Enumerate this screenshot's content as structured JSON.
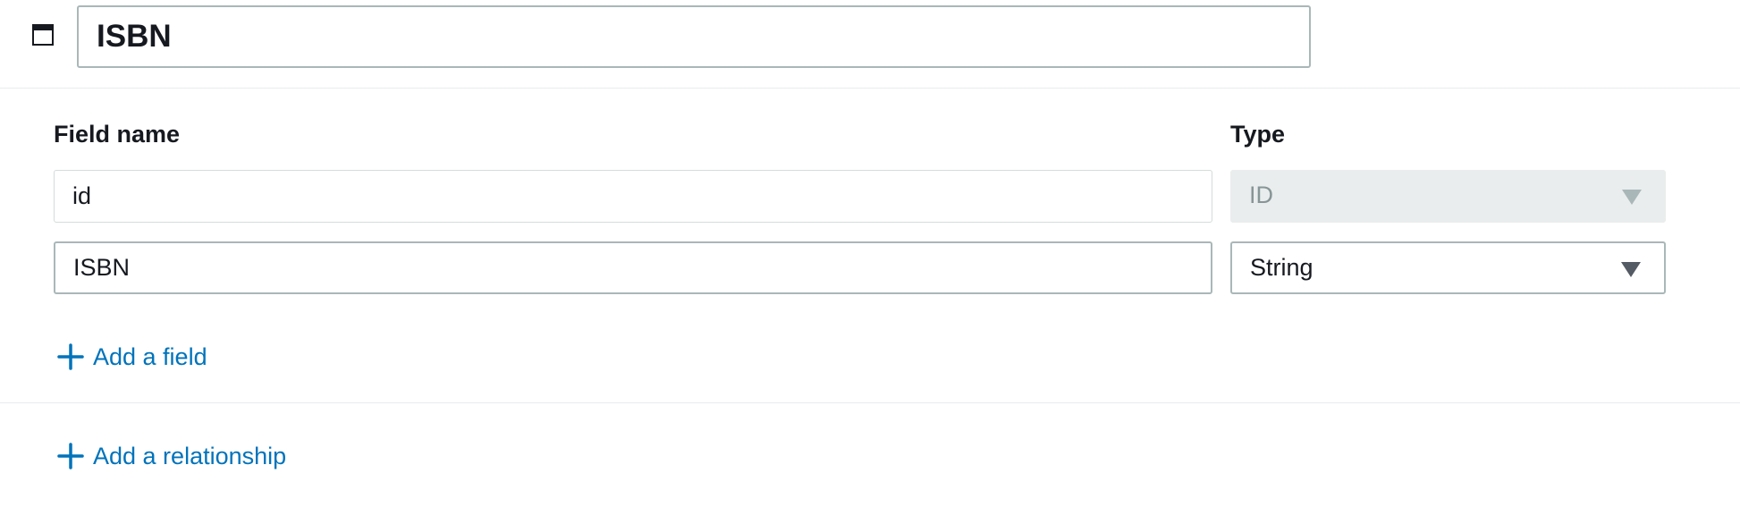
{
  "model": {
    "name": "ISBN",
    "icon": "window-icon"
  },
  "fields_table": {
    "headers": {
      "field_name": "Field name",
      "type": "Type"
    },
    "rows": [
      {
        "name": "id",
        "type": "ID",
        "editable": false
      },
      {
        "name": "ISBN",
        "type": "String",
        "editable": true
      }
    ],
    "add_field_label": "Add a field"
  },
  "relationships": {
    "add_relationship_label": "Add a relationship"
  },
  "colors": {
    "link": "#0073bb",
    "text": "#16191f",
    "disabled_text": "#879596",
    "disabled_bg": "#eaeded",
    "border": "#aab7b8"
  }
}
